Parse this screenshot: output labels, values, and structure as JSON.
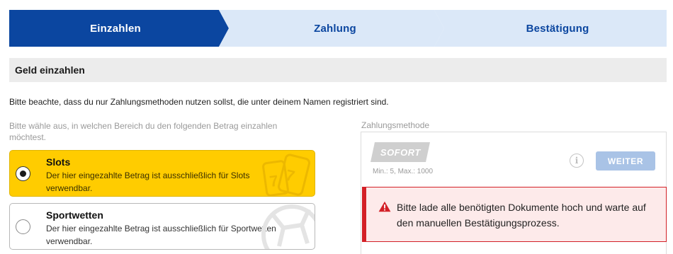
{
  "stepper": {
    "steps": [
      {
        "label": "Einzahlen",
        "active": true
      },
      {
        "label": "Zahlung",
        "active": false
      },
      {
        "label": "Bestätigung",
        "active": false
      }
    ]
  },
  "section": {
    "title": "Geld einzahlen"
  },
  "notice": "Bitte beachte, dass du nur Zahlungsmethoden nutzen sollst, die unter deinem Namen registriert sind.",
  "area_selection": {
    "label": "Bitte wähle aus, in welchen Bereich du den folgenden Betrag einzahlen möchtest.",
    "options": [
      {
        "title": "Slots",
        "description": "Der hier eingezahlte Betrag ist ausschließlich für Slots verwendbar.",
        "selected": true,
        "icon": "slot-machine-icon"
      },
      {
        "title": "Sportwetten",
        "description": "Der hier eingezahlte Betrag ist ausschließlich für Sportwetten verwendbar.",
        "selected": false,
        "icon": "football-icon"
      }
    ]
  },
  "payment": {
    "label": "Zahlungsmethode",
    "method_logo": "SOFORT",
    "limits": "Min.: 5, Max.: 1000",
    "info_icon": "info-icon",
    "button_label": "WEITER"
  },
  "alert": {
    "icon": "warning-icon",
    "message": "Bitte lade alle benötigten Dokumente hoch und warte auf den manuellen Bestätigungsprozess."
  },
  "colors": {
    "primary": "#0b46a0",
    "step_inactive": "#dbe8f8",
    "selected_option": "#ffcc00",
    "button_disabled": "#a9c3e6",
    "alert_red": "#d32027",
    "alert_bg": "#fdeaea"
  }
}
